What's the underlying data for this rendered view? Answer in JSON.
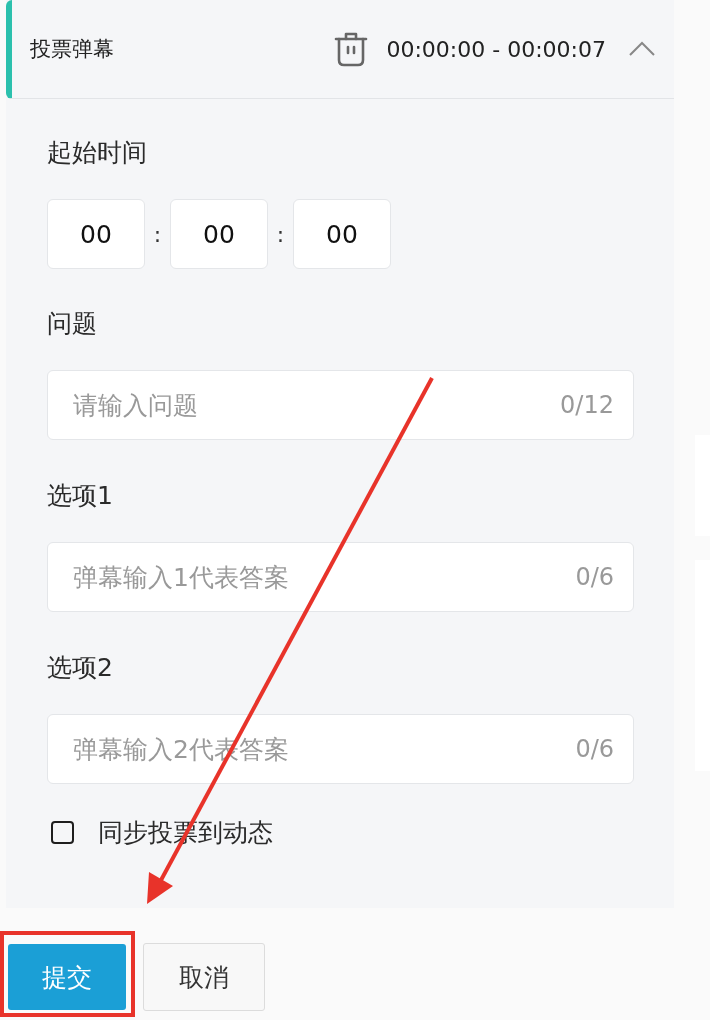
{
  "header": {
    "title": "投票弹幕",
    "time_range": "00:00:00 - 00:00:07",
    "expanded": true
  },
  "start_time": {
    "label": "起始时间",
    "fields": [
      {
        "value": "00"
      },
      {
        "value": "00"
      },
      {
        "value": "00"
      }
    ],
    "separators": [
      ":",
      ":"
    ]
  },
  "fields": [
    {
      "label": "问题",
      "placeholder": "请输入问题",
      "counter": "0/12"
    },
    {
      "label": "选项1",
      "placeholder": "弹幕输入1代表答案",
      "counter": "0/6"
    },
    {
      "label": "选项2",
      "placeholder": "弹幕输入2代表答案",
      "counter": "0/6"
    }
  ],
  "sync_checkbox": {
    "label": "同步投票到动态",
    "checked": false
  },
  "buttons": [
    {
      "label": "提交",
      "kind": "primary"
    },
    {
      "label": "取消",
      "kind": "secondary"
    }
  ]
}
